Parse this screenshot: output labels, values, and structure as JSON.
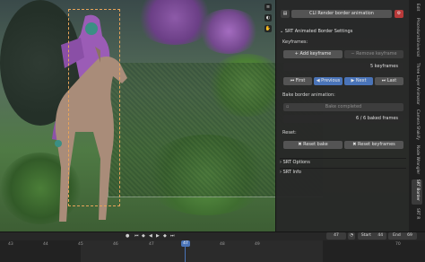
{
  "panel": {
    "header_button": "CLI Render border animation",
    "section_title": "SRT Animated Border Settings",
    "keyframes_label": "Keyframes:",
    "add_keyframe": "Add keyframe",
    "remove_keyframe": "Remove keyframe",
    "keyframe_count": "5 keyframes",
    "nav_first": "First",
    "nav_previous": "Previous",
    "nav_next": "Next",
    "nav_last": "Last",
    "bake_label": "Bake border animation:",
    "bake_status": "Bake completed",
    "baked_count": "6 / 6 baked frames",
    "reset_label": "Reset:",
    "reset_bake": "Reset bake",
    "reset_keyframes": "Reset keyframes",
    "srt_options": "SRT Options",
    "srt_info": "SRT Info"
  },
  "tabs": [
    "Edit",
    "ProceduralUniversal",
    "Three Layer Animator",
    "Camera Shakify",
    "Node Wrangler",
    "SRT Border",
    "SRT R"
  ],
  "active_tab_index": 5,
  "timeline": {
    "current_frame": "47",
    "start_label": "Start",
    "start_value": "44",
    "end_label": "End",
    "end_value": "69",
    "ruler": [
      "43",
      "44",
      "45",
      "46",
      "47",
      "48",
      "49",
      "70"
    ],
    "active_ruler": "47"
  },
  "colors": {
    "accent": "#4a74b8",
    "selection": "#e8a45a",
    "panel_bg": "#282828",
    "button": "#545454",
    "danger_icon": "#b83a3a"
  }
}
